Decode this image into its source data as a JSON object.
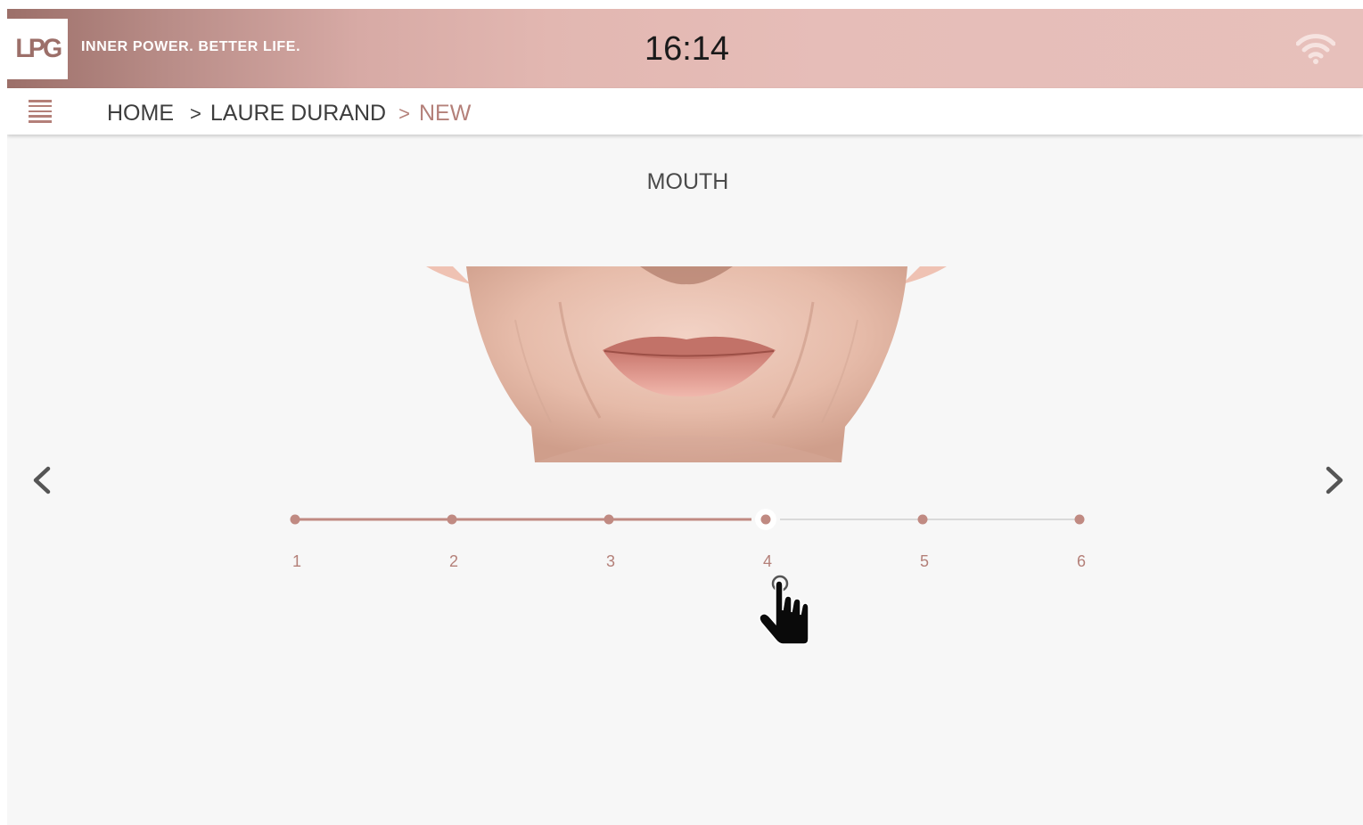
{
  "header": {
    "logo_text": "LPG",
    "tagline": "INNER POWER. BETTER LIFE.",
    "time": "16:14",
    "wifi_icon": "wifi-icon"
  },
  "breadcrumb": {
    "home": "HOME",
    "separator": ">",
    "client": "LAURE DURAND",
    "current": "NEW"
  },
  "main": {
    "section_title": "MOUTH",
    "image_alt": "mouth area",
    "prev_icon": "chevron-left-icon",
    "next_icon": "chevron-right-icon"
  },
  "slider": {
    "steps": [
      "1",
      "2",
      "3",
      "4",
      "5",
      "6"
    ],
    "selected": 4,
    "active_color": "#c08a82",
    "inactive_color": "#d0d0d0"
  },
  "colors": {
    "accent": "#b48079",
    "brand": "#9c6f69"
  }
}
